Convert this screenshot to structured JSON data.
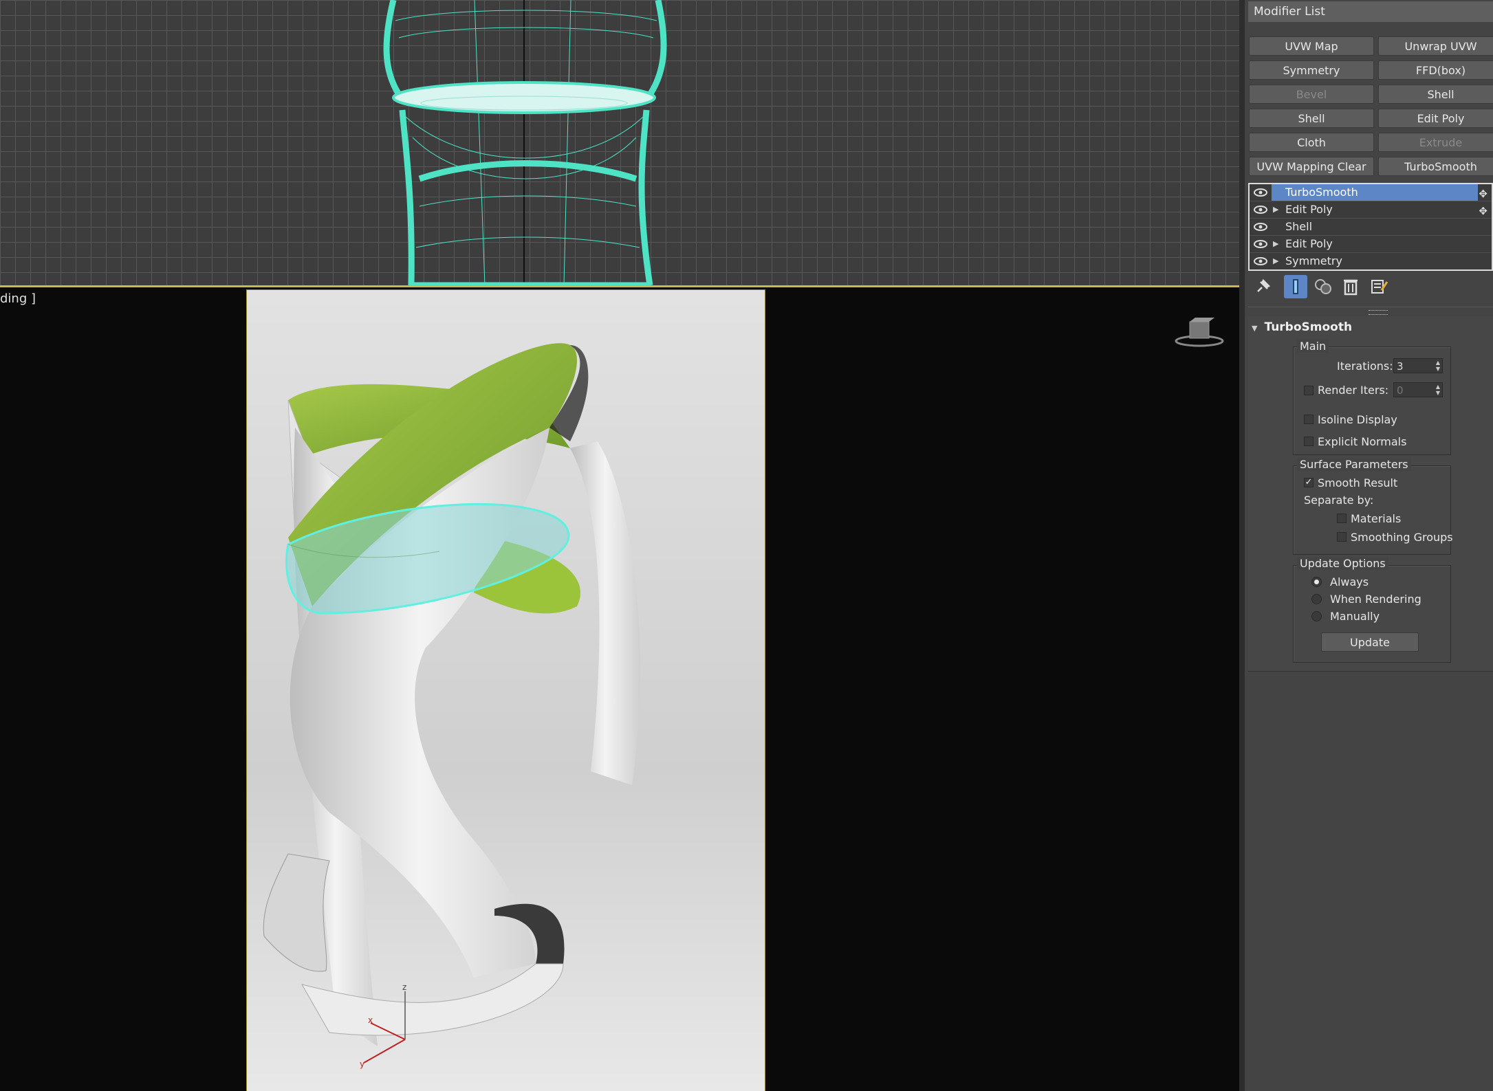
{
  "viewport_bottom": {
    "label": "ding ]"
  },
  "modifier_list": {
    "title": "Modifier List",
    "buttons": [
      {
        "label": "UVW Map",
        "enabled": true
      },
      {
        "label": "Unwrap UVW",
        "enabled": true
      },
      {
        "label": "Symmetry",
        "enabled": true
      },
      {
        "label": "FFD(box)",
        "enabled": true
      },
      {
        "label": "Bevel",
        "enabled": false
      },
      {
        "label": "Shell",
        "enabled": true
      },
      {
        "label": "Shell",
        "enabled": true
      },
      {
        "label": "Edit Poly",
        "enabled": true
      },
      {
        "label": "Cloth",
        "enabled": true
      },
      {
        "label": "Extrude",
        "enabled": false
      },
      {
        "label": "UVW Mapping Clear",
        "enabled": true
      },
      {
        "label": "TurboSmooth",
        "enabled": true
      }
    ]
  },
  "stack": [
    {
      "name": "TurboSmooth",
      "selected": true,
      "expandable": false
    },
    {
      "name": "Edit Poly",
      "selected": false,
      "expandable": true
    },
    {
      "name": "Shell",
      "selected": false,
      "expandable": false
    },
    {
      "name": "Edit Poly",
      "selected": false,
      "expandable": true
    },
    {
      "name": "Symmetry",
      "selected": false,
      "expandable": true
    }
  ],
  "tools": [
    "pin-stack-icon",
    "show-end-result-icon",
    "make-unique-icon",
    "remove-modifier-icon",
    "configure-modifier-sets-icon"
  ],
  "rollout": {
    "title": "TurboSmooth",
    "main": {
      "label": "Main",
      "iterations_label": "Iterations:",
      "iterations_value": "3",
      "render_iters_label": "Render Iters:",
      "render_iters_value": "0",
      "render_iters_checked": false,
      "isoline_label": "Isoline Display",
      "isoline_checked": false,
      "explicit_normals_label": "Explicit Normals",
      "explicit_normals_checked": false
    },
    "surface": {
      "label": "Surface Parameters",
      "smooth_result_label": "Smooth Result",
      "smooth_result_checked": true,
      "separate_by_label": "Separate by:",
      "materials_label": "Materials",
      "smoothing_groups_label": "Smoothing Groups"
    },
    "update": {
      "label": "Update Options",
      "options": [
        "Always",
        "When Rendering",
        "Manually"
      ],
      "selected": "Always",
      "button_label": "Update"
    }
  },
  "colors": {
    "wire": "#4fe3c6",
    "selection": "#5d86c6",
    "viewport_border": "#c9b84a",
    "chair_green": "#8fb83a"
  }
}
